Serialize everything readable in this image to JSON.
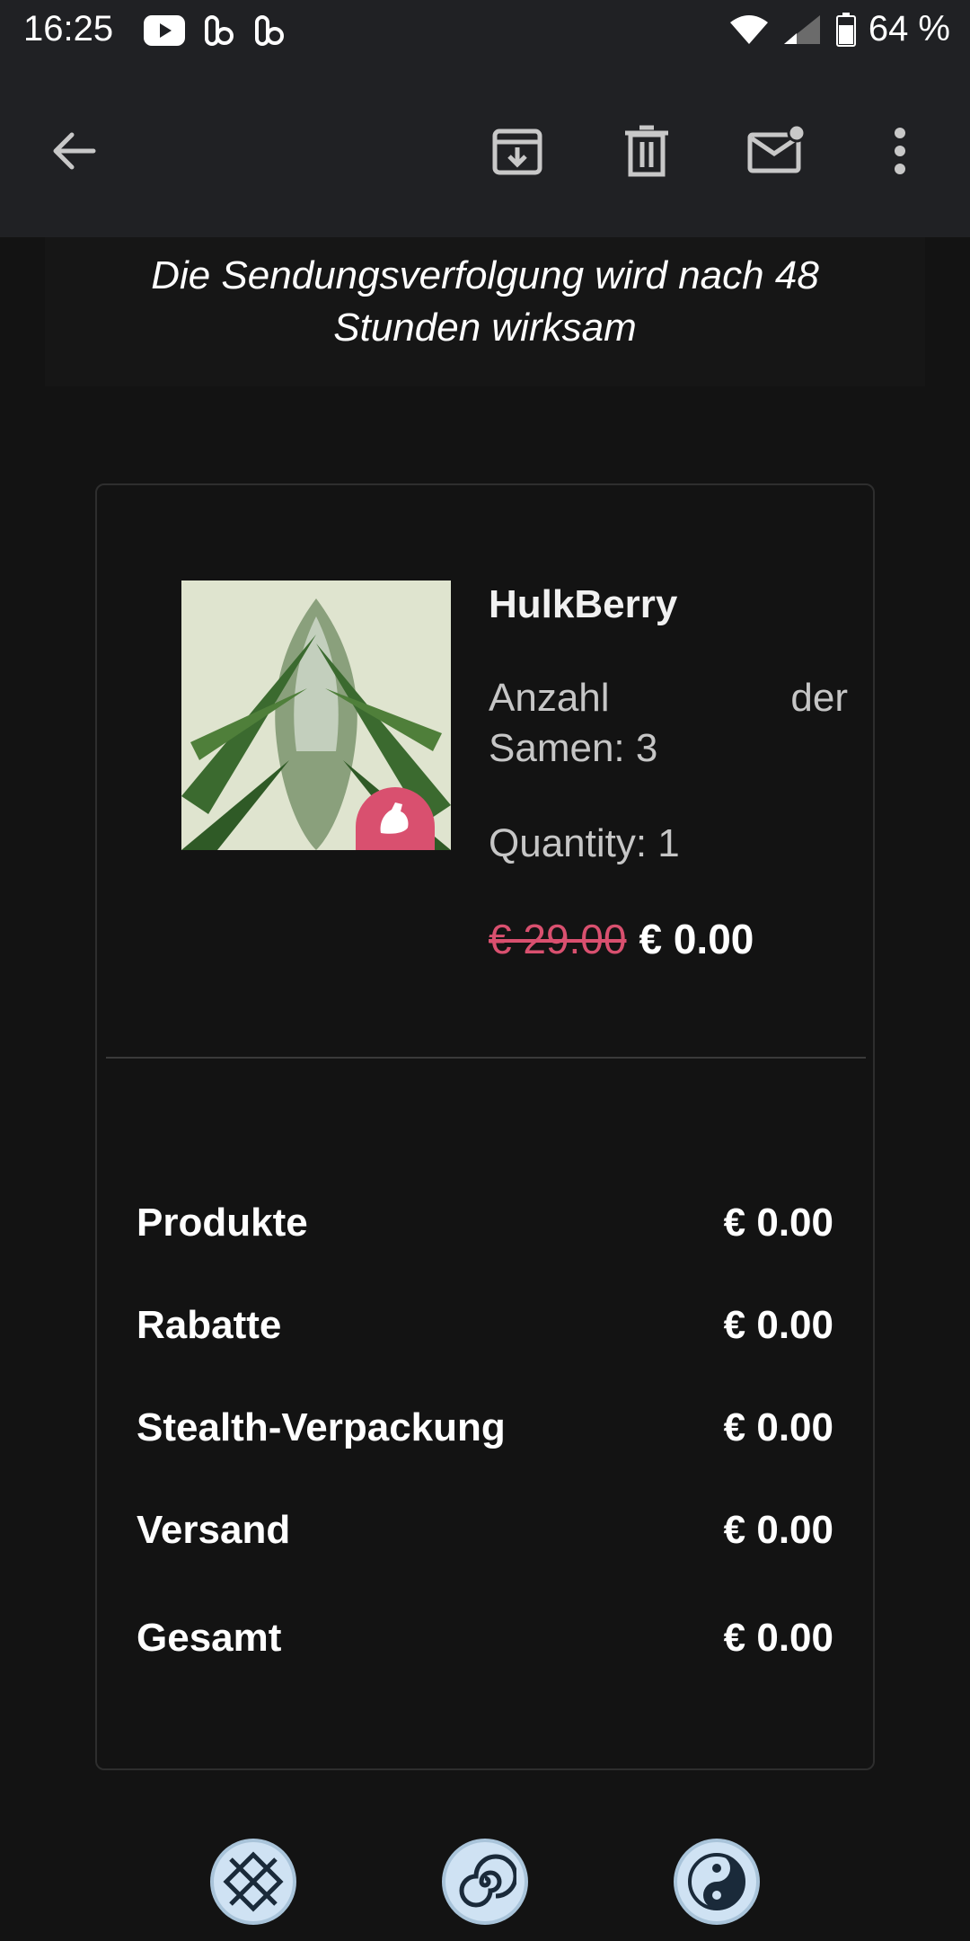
{
  "status_bar": {
    "time": "16:25",
    "battery": "64 %",
    "icons": [
      "youtube-icon",
      "app-icon",
      "app-icon",
      "wifi-icon",
      "signal-icon",
      "battery-icon"
    ]
  },
  "app_bar": {
    "icons": [
      "back-arrow-icon",
      "archive-icon",
      "delete-icon",
      "mark-unread-icon",
      "more-vert-icon"
    ]
  },
  "notice": {
    "line1": "Die Sendungsverfolgung wird nach 48",
    "line2": "Stunden wirksam"
  },
  "product": {
    "name": "HulkBerry",
    "seeds_word1": "Anzahl",
    "seeds_word2": "der",
    "seeds_line2": "Samen: 3",
    "quantity": "Quantity: 1",
    "price_old": "€ 29.00",
    "price_new": "€ 0.00",
    "badge_icon": "muscle-icon"
  },
  "summary": [
    {
      "label": "Produkte",
      "value": "€ 0.00"
    },
    {
      "label": "Rabatte",
      "value": "€ 0.00"
    },
    {
      "label": "Stealth-Verpackung",
      "value": "€ 0.00"
    },
    {
      "label": "Versand",
      "value": "€ 0.00"
    },
    {
      "label": "Gesamt",
      "value": "€ 0.00"
    }
  ],
  "bottom_icons": [
    "crosshatch-circle-icon",
    "spiral-icon",
    "yin-yang-icon"
  ],
  "colors": {
    "background": "#131313",
    "bar": "#202124",
    "accent": "#d9506f"
  }
}
